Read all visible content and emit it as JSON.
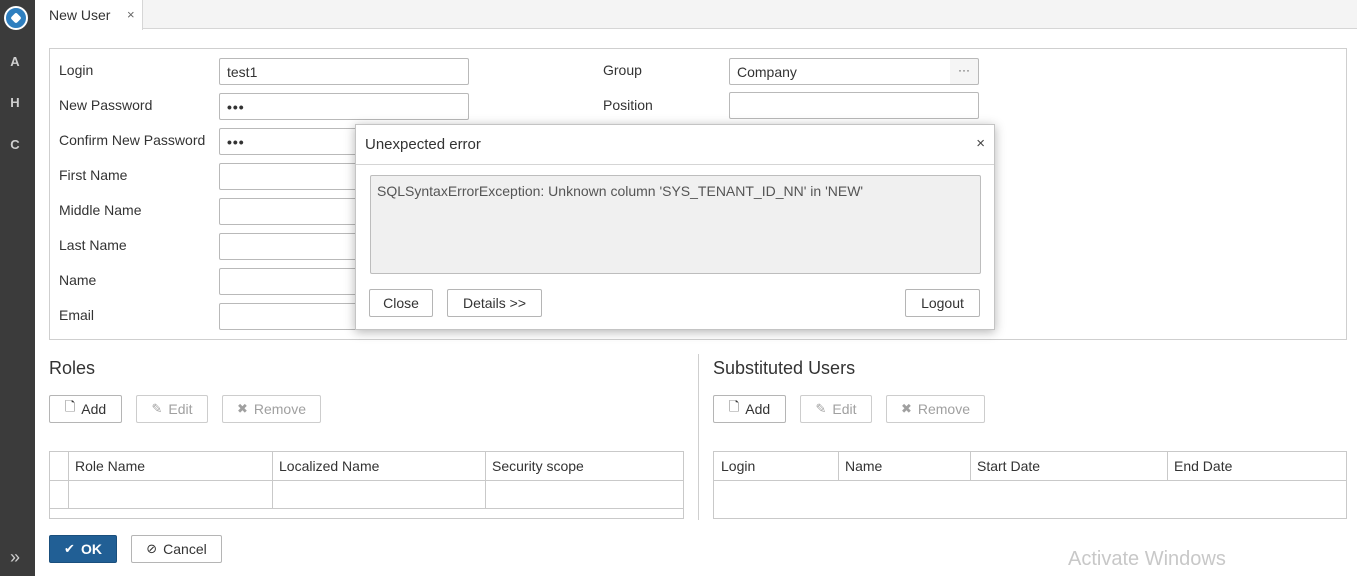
{
  "rail": {
    "letters": [
      "A",
      "H",
      "C"
    ],
    "expand_glyph": "»"
  },
  "tab": {
    "label": "New User",
    "close": "×"
  },
  "form": {
    "login_label": "Login",
    "login_value": "test1",
    "new_password_label": "New Password",
    "new_password_value": "•••",
    "confirm_password_label": "Confirm New Password",
    "confirm_password_value": "•••",
    "first_name_label": "First Name",
    "middle_name_label": "Middle Name",
    "last_name_label": "Last Name",
    "name_label": "Name",
    "email_label": "Email",
    "group_label": "Group",
    "group_value": "Company",
    "group_picker": "···",
    "position_label": "Position"
  },
  "roles": {
    "title": "Roles",
    "add_label": "Add",
    "edit_label": "Edit",
    "remove_label": "Remove",
    "columns": [
      "Role Name",
      "Localized Name",
      "Security scope"
    ]
  },
  "substituted": {
    "title": "Substituted Users",
    "add_label": "Add",
    "edit_label": "Edit",
    "remove_label": "Remove",
    "columns": [
      "Login",
      "Name",
      "Start Date",
      "End Date"
    ]
  },
  "footer": {
    "ok_label": "OK",
    "cancel_label": "Cancel"
  },
  "dialog": {
    "title": "Unexpected error",
    "close_glyph": "×",
    "message": "SQLSyntaxErrorException: Unknown column 'SYS_TENANT_ID_NN' in 'NEW'",
    "close_label": "Close",
    "details_label": "Details >>",
    "logout_label": "Logout"
  },
  "watermark": "Activate Windows",
  "colors": {
    "primary": "#215f95",
    "rail": "#3b3b3b",
    "logo": "#2f7fbf"
  }
}
